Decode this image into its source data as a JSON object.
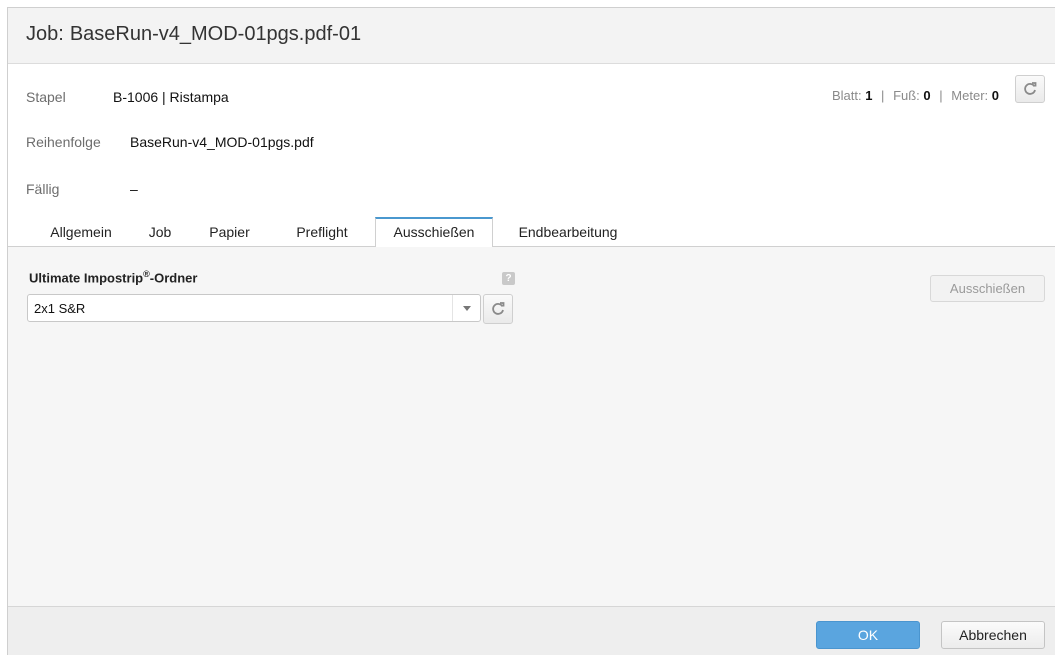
{
  "header": {
    "job_prefix": "Job:",
    "job_name": "BaseRun-v4_MOD-01pgs.pdf-01"
  },
  "info": {
    "stapel_label": "Stapel",
    "stapel_value": "B-1006 | Ristampa",
    "reihenfolge_label": "Reihenfolge",
    "reihenfolge_value": "BaseRun-v4_MOD-01pgs.pdf",
    "faellig_label": "Fällig",
    "faellig_value": "–"
  },
  "counters": {
    "blatt_label": "Blatt:",
    "blatt_value": "1",
    "fuss_label": "Fuß:",
    "fuss_value": "0",
    "meter_label": "Meter:",
    "meter_value": "0",
    "separator": "|"
  },
  "tabs": [
    {
      "label": "Allgemein",
      "active": false
    },
    {
      "label": "Job",
      "active": false
    },
    {
      "label": "Papier",
      "active": false
    },
    {
      "label": "Preflight",
      "active": false
    },
    {
      "label": "Ausschießen",
      "active": true
    },
    {
      "label": "Endbearbeitung",
      "active": false
    }
  ],
  "impose": {
    "label_main": "Ultimate Impostrip",
    "label_sup": "®",
    "label_tail": "-Ordner",
    "help_glyph": "?",
    "selected_value": "2x1 S&R",
    "action_button": "Ausschießen"
  },
  "footer": {
    "ok_label": "OK",
    "cancel_label": "Abbrechen"
  },
  "colors": {
    "accent": "#5aa5df",
    "tab_active_border": "#4a98cf"
  },
  "icons": {
    "refresh": "refresh-icon",
    "dropdown": "chevron-down-icon",
    "help": "help-icon"
  }
}
